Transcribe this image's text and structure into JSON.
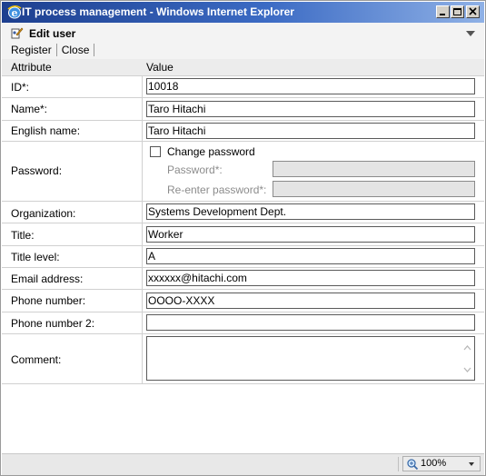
{
  "window": {
    "title": "IT process management - Windows Internet Explorer"
  },
  "header": {
    "title": "Edit user"
  },
  "toolbar": {
    "register_label": "Register",
    "close_label": "Close"
  },
  "columns": {
    "attribute": "Attribute",
    "value": "Value"
  },
  "form": {
    "id": {
      "label": "ID*:",
      "value": "10018"
    },
    "name": {
      "label": "Name*:",
      "value": "Taro Hitachi"
    },
    "english_name": {
      "label": "English name:",
      "value": "Taro Hitachi"
    },
    "password": {
      "label": "Password:",
      "change_label": "Change password",
      "change_checked": false,
      "password_label": "Password*:",
      "reenter_label": "Re-enter password*:"
    },
    "organization": {
      "label": "Organization:",
      "value": "Systems Development Dept."
    },
    "title": {
      "label": "Title:",
      "value": "Worker"
    },
    "title_level": {
      "label": "Title level:",
      "value": "A"
    },
    "email": {
      "label": "Email address:",
      "value": "xxxxxx@hitachi.com"
    },
    "phone": {
      "label": "Phone number:",
      "value": "OOOO-XXXX"
    },
    "phone2": {
      "label": "Phone number 2:",
      "value": ""
    },
    "comment": {
      "label": "Comment:",
      "value": ""
    }
  },
  "statusbar": {
    "zoom": "100%"
  },
  "icons": {
    "app": "internet-explorer-icon",
    "edit": "edit-user-icon",
    "zoom": "magnifier-icon"
  }
}
